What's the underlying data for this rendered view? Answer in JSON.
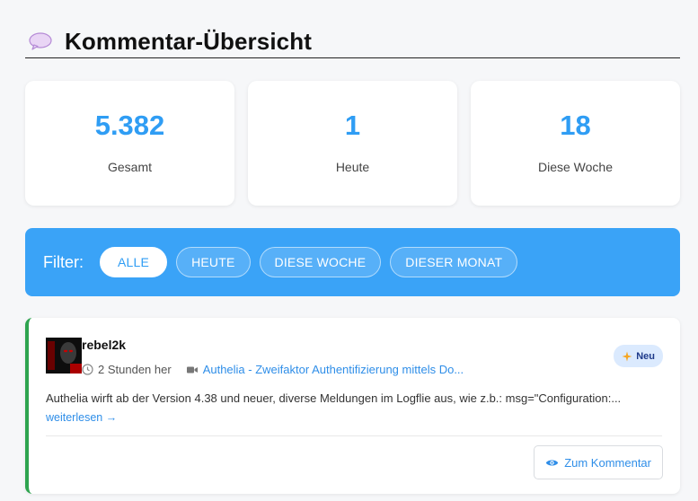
{
  "header": {
    "title": "Kommentar-Übersicht",
    "icon": "speech-bubble-icon"
  },
  "stats": [
    {
      "value": "5.382",
      "label": "Gesamt"
    },
    {
      "value": "1",
      "label": "Heute"
    },
    {
      "value": "18",
      "label": "Diese Woche"
    }
  ],
  "filter": {
    "label": "Filter:",
    "options": [
      "ALLE",
      "HEUTE",
      "DIESE WOCHE",
      "DIESER MONAT"
    ],
    "active": "ALLE"
  },
  "comments": [
    {
      "username": "rebel2k",
      "time": "2 Stunden her",
      "post_title": "Authelia - Zweifaktor Authentifizierung mittels Do...",
      "badge": "Neu",
      "excerpt": "Authelia wirft ab der Version 4.38 und neuer, diverse Meldungen im Logflie aus, wie z.b.: msg=\"Configuration:...",
      "read_more": "weiterlesen →",
      "button_label": "Zum Kommentar"
    }
  ],
  "colors": {
    "accent": "#2f9df4",
    "filter_bar": "#3aa3f7",
    "comment_border": "#2ea44f",
    "badge_bg": "#dbeafe"
  }
}
